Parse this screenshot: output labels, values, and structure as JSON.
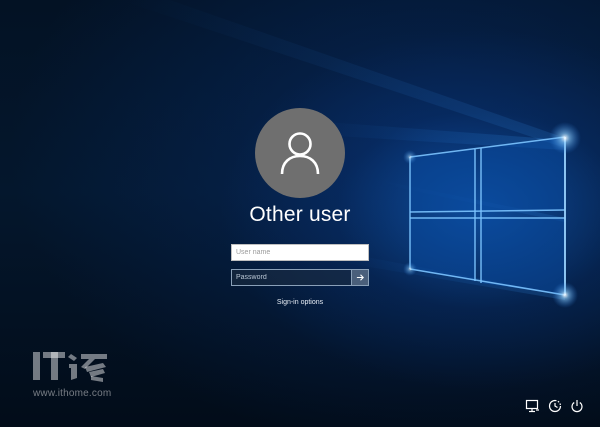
{
  "login": {
    "display_name": "Other user",
    "username_placeholder": "User name",
    "password_placeholder": "Password",
    "signin_options_label": "Sign-in options"
  },
  "watermark": {
    "logo_text": "IT之家",
    "site": "www.ithome.com"
  },
  "tray_icons": [
    "network-icon",
    "ease-of-access-icon",
    "power-icon"
  ],
  "colors": {
    "background": "#031224",
    "accent_glow": "#1e78dc",
    "avatar": "#6f6f6f"
  }
}
